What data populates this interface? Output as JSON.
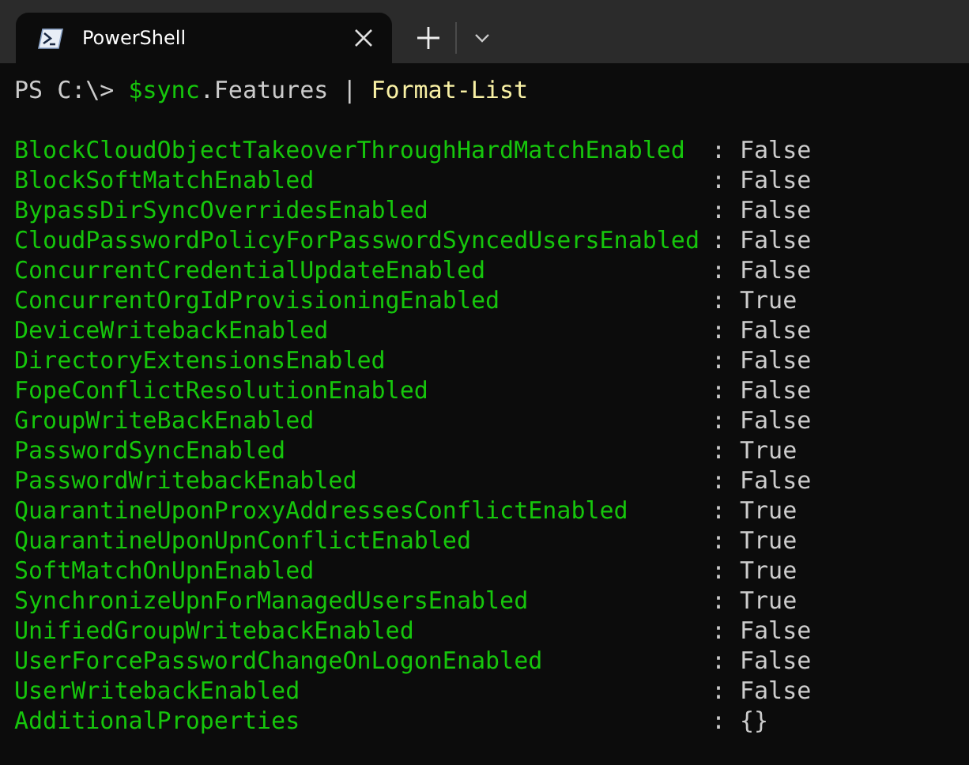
{
  "tabs": [
    {
      "title": "PowerShell",
      "selected": true
    }
  ],
  "command": [
    {
      "kind": "prompt",
      "text": "PS C:\\>"
    },
    {
      "kind": "variable",
      "text": "$sync"
    },
    {
      "kind": "plain",
      "text": ".Features"
    },
    {
      "kind": "plain",
      "text": "|"
    },
    {
      "kind": "command",
      "text": "Format-List"
    }
  ],
  "rows": [
    {
      "name": "BlockCloudObjectTakeoverThroughHardMatchEnabled",
      "separator": ":",
      "value": "False"
    },
    {
      "name": "BlockSoftMatchEnabled",
      "separator": ":",
      "value": "False"
    },
    {
      "name": "BypassDirSyncOverridesEnabled",
      "separator": ":",
      "value": "False"
    },
    {
      "name": "CloudPasswordPolicyForPasswordSyncedUsersEnabled",
      "separator": ":",
      "value": "False"
    },
    {
      "name": "ConcurrentCredentialUpdateEnabled",
      "separator": ":",
      "value": "False"
    },
    {
      "name": "ConcurrentOrgIdProvisioningEnabled",
      "separator": ":",
      "value": "True"
    },
    {
      "name": "DeviceWritebackEnabled",
      "separator": ":",
      "value": "False"
    },
    {
      "name": "DirectoryExtensionsEnabled",
      "separator": ":",
      "value": "False"
    },
    {
      "name": "FopeConflictResolutionEnabled",
      "separator": ":",
      "value": "False"
    },
    {
      "name": "GroupWriteBackEnabled",
      "separator": ":",
      "value": "False"
    },
    {
      "name": "PasswordSyncEnabled",
      "separator": ":",
      "value": "True"
    },
    {
      "name": "PasswordWritebackEnabled",
      "separator": ":",
      "value": "False"
    },
    {
      "name": "QuarantineUponProxyAddressesConflictEnabled",
      "separator": ":",
      "value": "True"
    },
    {
      "name": "QuarantineUponUpnConflictEnabled",
      "separator": ":",
      "value": "True"
    },
    {
      "name": "SoftMatchOnUpnEnabled",
      "separator": ":",
      "value": "True"
    },
    {
      "name": "SynchronizeUpnForManagedUsersEnabled",
      "separator": ":",
      "value": "True"
    },
    {
      "name": "UnifiedGroupWritebackEnabled",
      "separator": ":",
      "value": "False"
    },
    {
      "name": "UserForcePasswordChangeOnLogonEnabled",
      "separator": ":",
      "value": "False"
    },
    {
      "name": "UserWritebackEnabled",
      "separator": ":",
      "value": "False"
    },
    {
      "name": "AdditionalProperties",
      "separator": ":",
      "value": "{}"
    }
  ]
}
